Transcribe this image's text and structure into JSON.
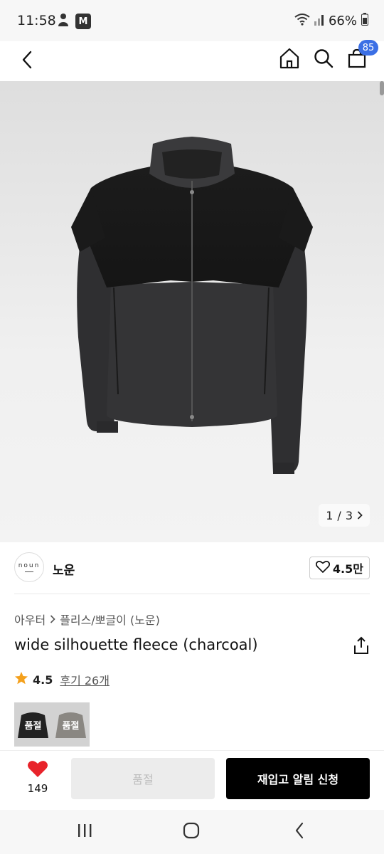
{
  "status_bar": {
    "time": "11:58",
    "m_badge": "M",
    "battery": "66%"
  },
  "header": {
    "cart_count": "85"
  },
  "gallery": {
    "page_current": "1",
    "page_separator": "/",
    "page_total": "3"
  },
  "brand": {
    "logo_text": "noun",
    "name": "노운",
    "like_count": "4.5만"
  },
  "breadcrumb": {
    "category": "아우터",
    "subcategory": "플리스/뽀글이 (노운)"
  },
  "product": {
    "title": "wide silhouette fleece (charcoal)",
    "rating": "4.5",
    "reviews_label": "후기 26개"
  },
  "swatches": [
    {
      "label": "품절",
      "color": "#2a2a2a"
    },
    {
      "label": "품절",
      "color": "#8a8782"
    }
  ],
  "bottom": {
    "heart_count": "149",
    "soldout_label": "품절",
    "restock_label": "재입고 알림 신청"
  },
  "colors": {
    "accent_blue": "#3b6fe5",
    "heart_red": "#e8232a",
    "star_orange": "#f4a01c"
  }
}
